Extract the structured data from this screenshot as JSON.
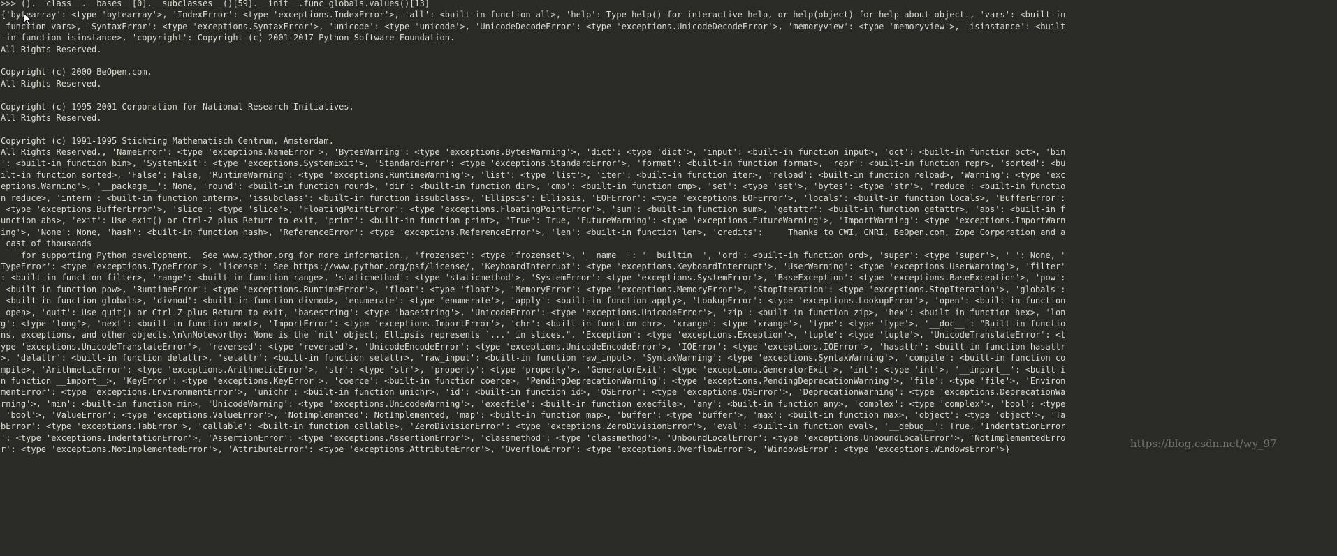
{
  "console": {
    "lines": [
      ">>> ().__class__.__bases__[0].__subclasses__()[59].__init__.func_globals.values()[13]",
      "{'bytearray': <type 'bytearray'>, 'IndexError': <type 'exceptions.IndexError'>, 'all': <built-in function all>, 'help': Type help() for interactive help, or help(object) for help about object., 'vars': <built-in",
      " function vars>, 'SyntaxError': <type 'exceptions.SyntaxError'>, 'unicode': <type 'unicode'>, 'UnicodeDecodeError': <type 'exceptions.UnicodeDecodeError'>, 'memoryview': <type 'memoryview'>, 'isinstance': <built",
      "-in function isinstance>, 'copyright': Copyright (c) 2001-2017 Python Software Foundation.",
      "All Rights Reserved.",
      "",
      "Copyright (c) 2000 BeOpen.com.",
      "All Rights Reserved.",
      "",
      "Copyright (c) 1995-2001 Corporation for National Research Initiatives.",
      "All Rights Reserved.",
      "",
      "Copyright (c) 1991-1995 Stichting Mathematisch Centrum, Amsterdam.",
      "All Rights Reserved., 'NameError': <type 'exceptions.NameError'>, 'BytesWarning': <type 'exceptions.BytesWarning'>, 'dict': <type 'dict'>, 'input': <built-in function input>, 'oct': <built-in function oct>, 'bin",
      "': <built-in function bin>, 'SystemExit': <type 'exceptions.SystemExit'>, 'StandardError': <type 'exceptions.StandardError'>, 'format': <built-in function format>, 'repr': <built-in function repr>, 'sorted': <bu",
      "ilt-in function sorted>, 'False': False, 'RuntimeWarning': <type 'exceptions.RuntimeWarning'>, 'list': <type 'list'>, 'iter': <built-in function iter>, 'reload': <built-in function reload>, 'Warning': <type 'exc",
      "eptions.Warning'>, '__package__': None, 'round': <built-in function round>, 'dir': <built-in function dir>, 'cmp': <built-in function cmp>, 'set': <type 'set'>, 'bytes': <type 'str'>, 'reduce': <built-in functio",
      "n reduce>, 'intern': <built-in function intern>, 'issubclass': <built-in function issubclass>, 'Ellipsis': Ellipsis, 'EOFError': <type 'exceptions.EOFError'>, 'locals': <built-in function locals>, 'BufferError':",
      " <type 'exceptions.BufferError'>, 'slice': <type 'slice'>, 'FloatingPointError': <type 'exceptions.FloatingPointError'>, 'sum': <built-in function sum>, 'getattr': <built-in function getattr>, 'abs': <built-in f",
      "unction abs>, 'exit': Use exit() or Ctrl-Z plus Return to exit, 'print': <built-in function print>, 'True': True, 'FutureWarning': <type 'exceptions.FutureWarning'>, 'ImportWarning': <type 'exceptions.ImportWarn",
      "ing'>, 'None': None, 'hash': <built-in function hash>, 'ReferenceError': <type 'exceptions.ReferenceError'>, 'len': <built-in function len>, 'credits':     Thanks to CWI, CNRI, BeOpen.com, Zope Corporation and a",
      " cast of thousands",
      "    for supporting Python development.  See www.python.org for more information., 'frozenset': <type 'frozenset'>, '__name__': '__builtin__', 'ord': <built-in function ord>, 'super': <type 'super'>, '_': None, '",
      "TypeError': <type 'exceptions.TypeError'>, 'license': See https://www.python.org/psf/license/, 'KeyboardInterrupt': <type 'exceptions.KeyboardInterrupt'>, 'UserWarning': <type 'exceptions.UserWarning'>, 'filter'",
      ": <built-in function filter>, 'range': <built-in function range>, 'staticmethod': <type 'staticmethod'>, 'SystemError': <type 'exceptions.SystemError'>, 'BaseException': <type 'exceptions.BaseException'>, 'pow':",
      " <built-in function pow>, 'RuntimeError': <type 'exceptions.RuntimeError'>, 'float': <type 'float'>, 'MemoryError': <type 'exceptions.MemoryError'>, 'StopIteration': <type 'exceptions.StopIteration'>, 'globals':",
      " <built-in function globals>, 'divmod': <built-in function divmod>, 'enumerate': <type 'enumerate'>, 'apply': <built-in function apply>, 'LookupError': <type 'exceptions.LookupError'>, 'open': <built-in function",
      " open>, 'quit': Use quit() or Ctrl-Z plus Return to exit, 'basestring': <type 'basestring'>, 'UnicodeError': <type 'exceptions.UnicodeError'>, 'zip': <built-in function zip>, 'hex': <built-in function hex>, 'lon",
      "g': <type 'long'>, 'next': <built-in function next>, 'ImportError': <type 'exceptions.ImportError'>, 'chr': <built-in function chr>, 'xrange': <type 'xrange'>, 'type': <type 'type'>, '__doc__': \"Built-in functio",
      "ns, exceptions, and other objects.\\n\\nNoteworthy: None is the `nil' object; Ellipsis represents `...' in slices.\", 'Exception': <type 'exceptions.Exception'>, 'tuple': <type 'tuple'>, 'UnicodeTranslateError': <t",
      "ype 'exceptions.UnicodeTranslateError'>, 'reversed': <type 'reversed'>, 'UnicodeEncodeError': <type 'exceptions.UnicodeEncodeError'>, 'IOError': <type 'exceptions.IOError'>, 'hasattr': <built-in function hasattr",
      ">, 'delattr': <built-in function delattr>, 'setattr': <built-in function setattr>, 'raw_input': <built-in function raw_input>, 'SyntaxWarning': <type 'exceptions.SyntaxWarning'>, 'compile': <built-in function co",
      "mpile>, 'ArithmeticError': <type 'exceptions.ArithmeticError'>, 'str': <type 'str'>, 'property': <type 'property'>, 'GeneratorExit': <type 'exceptions.GeneratorExit'>, 'int': <type 'int'>, '__import__': <built-i",
      "n function __import__>, 'KeyError': <type 'exceptions.KeyError'>, 'coerce': <built-in function coerce>, 'PendingDeprecationWarning': <type 'exceptions.PendingDeprecationWarning'>, 'file': <type 'file'>, 'Environ",
      "mentError': <type 'exceptions.EnvironmentError'>, 'unichr': <built-in function unichr>, 'id': <built-in function id>, 'OSError': <type 'exceptions.OSError'>, 'DeprecationWarning': <type 'exceptions.DeprecationWa",
      "rning'>, 'min': <built-in function min>, 'UnicodeWarning': <type 'exceptions.UnicodeWarning'>, 'execfile': <built-in function execfile>, 'any': <built-in function any>, 'complex': <type 'complex'>, 'bool': <type",
      " 'bool'>, 'ValueError': <type 'exceptions.ValueError'>, 'NotImplemented': NotImplemented, 'map': <built-in function map>, 'buffer': <type 'buffer'>, 'max': <built-in function max>, 'object': <type 'object'>, 'Ta",
      "bError': <type 'exceptions.TabError'>, 'callable': <built-in function callable>, 'ZeroDivisionError': <type 'exceptions.ZeroDivisionError'>, 'eval': <built-in function eval>, '__debug__': True, 'IndentationError",
      "': <type 'exceptions.IndentationError'>, 'AssertionError': <type 'exceptions.AssertionError'>, 'classmethod': <type 'classmethod'>, 'UnboundLocalError': <type 'exceptions.UnboundLocalError'>, 'NotImplementedErro",
      "r': <type 'exceptions.NotImplementedError'>, 'AttributeError': <type 'exceptions.AttributeError'>, 'OverflowError': <type 'exceptions.OverflowError'>, 'WindowsError': <type 'exceptions.WindowsError'>}"
    ]
  },
  "watermark": "https://blog.csdn.net/wy_97",
  "colors": {
    "background": "#2b2b26",
    "text": "#dcdcd4"
  },
  "icons": {
    "cursor": "mouse-pointer-icon"
  }
}
